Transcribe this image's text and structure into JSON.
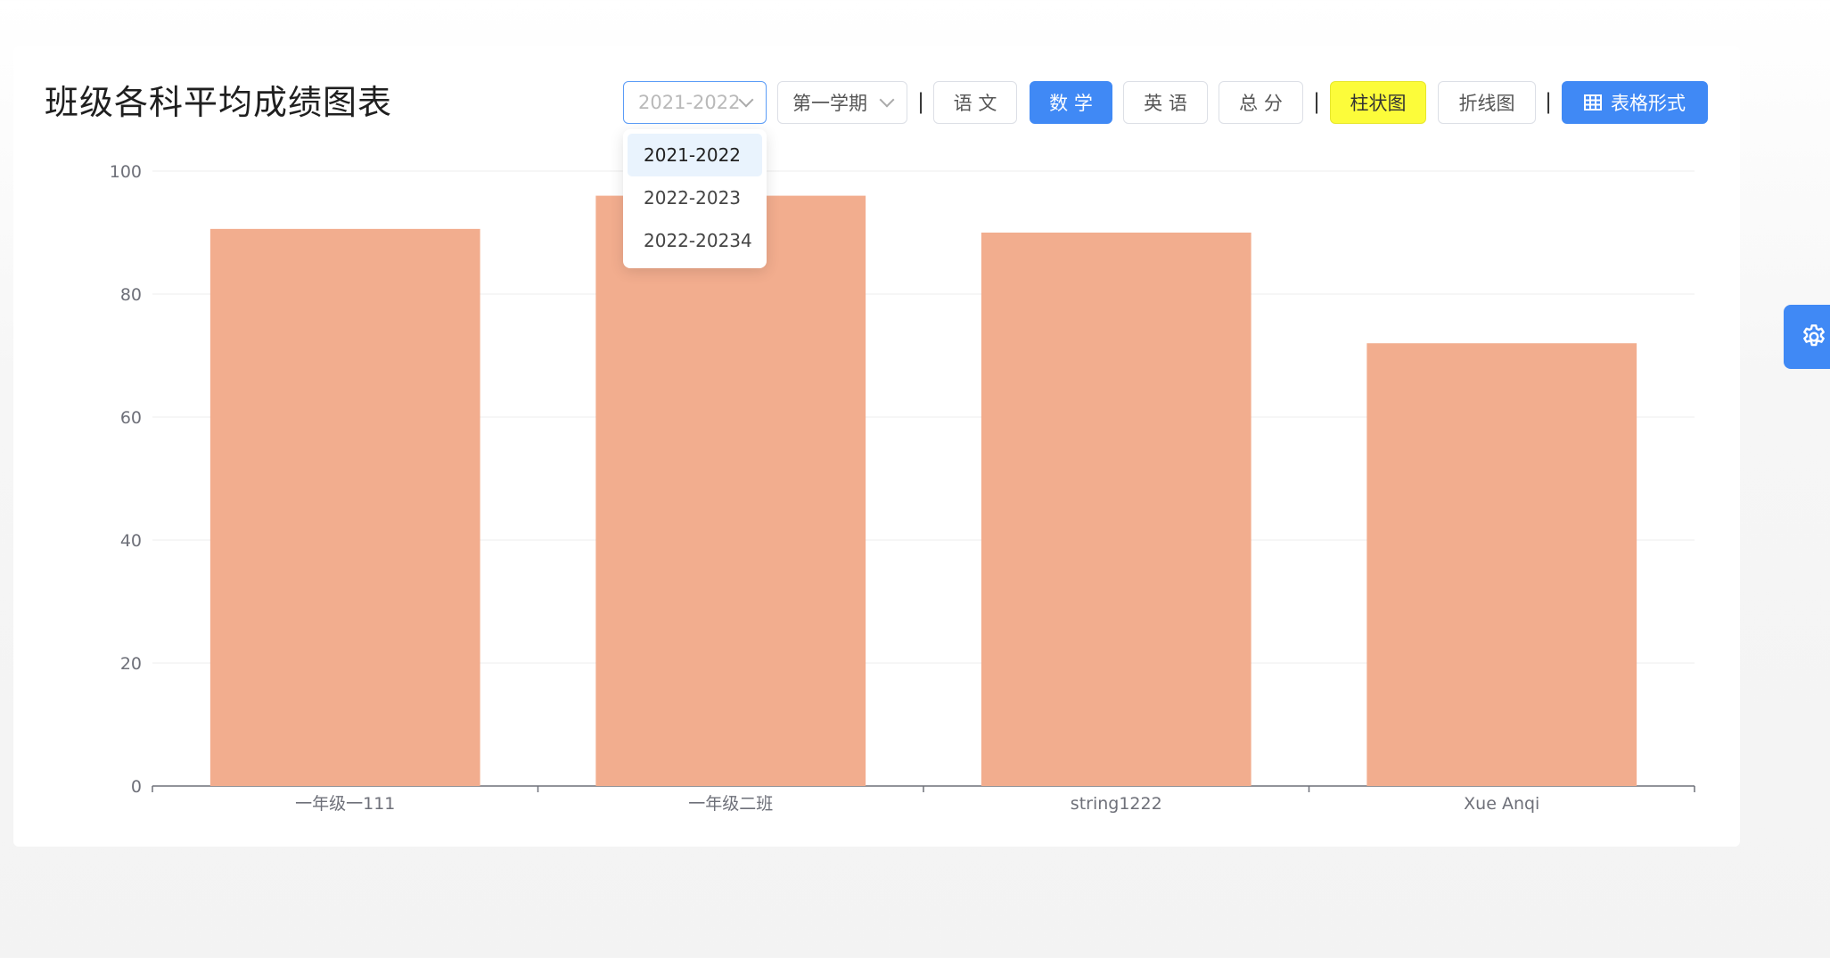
{
  "page": {
    "title": "班级各科平均成绩图表"
  },
  "filters": {
    "year": {
      "selected": "2021-2022",
      "options": [
        "2021-2022",
        "2022-2023",
        "2022-20234"
      ]
    },
    "term": {
      "selected": "第一学期"
    },
    "subjects": [
      "语 文",
      "数 学",
      "英 语",
      "总 分"
    ],
    "active_subject": "数 学",
    "chart_types": [
      "柱状图",
      "折线图"
    ],
    "active_chart_type": "柱状图",
    "table_button": "表格形式",
    "separator": "|"
  },
  "colors": {
    "bar": "#f2ad8e",
    "primary": "#4089f5",
    "highlight": "#fcfc3a"
  },
  "chart_data": {
    "type": "bar",
    "categories": [
      "一年级一111",
      "一年级二班",
      "string1222",
      "Xue Anqi"
    ],
    "values": [
      90.6,
      96,
      90,
      72
    ],
    "ylim": [
      0,
      100
    ],
    "yticks": [
      0,
      20,
      40,
      60,
      80,
      100
    ],
    "grid": true,
    "title": "",
    "xlabel": "",
    "ylabel": ""
  },
  "settings_icon": "gear-icon"
}
